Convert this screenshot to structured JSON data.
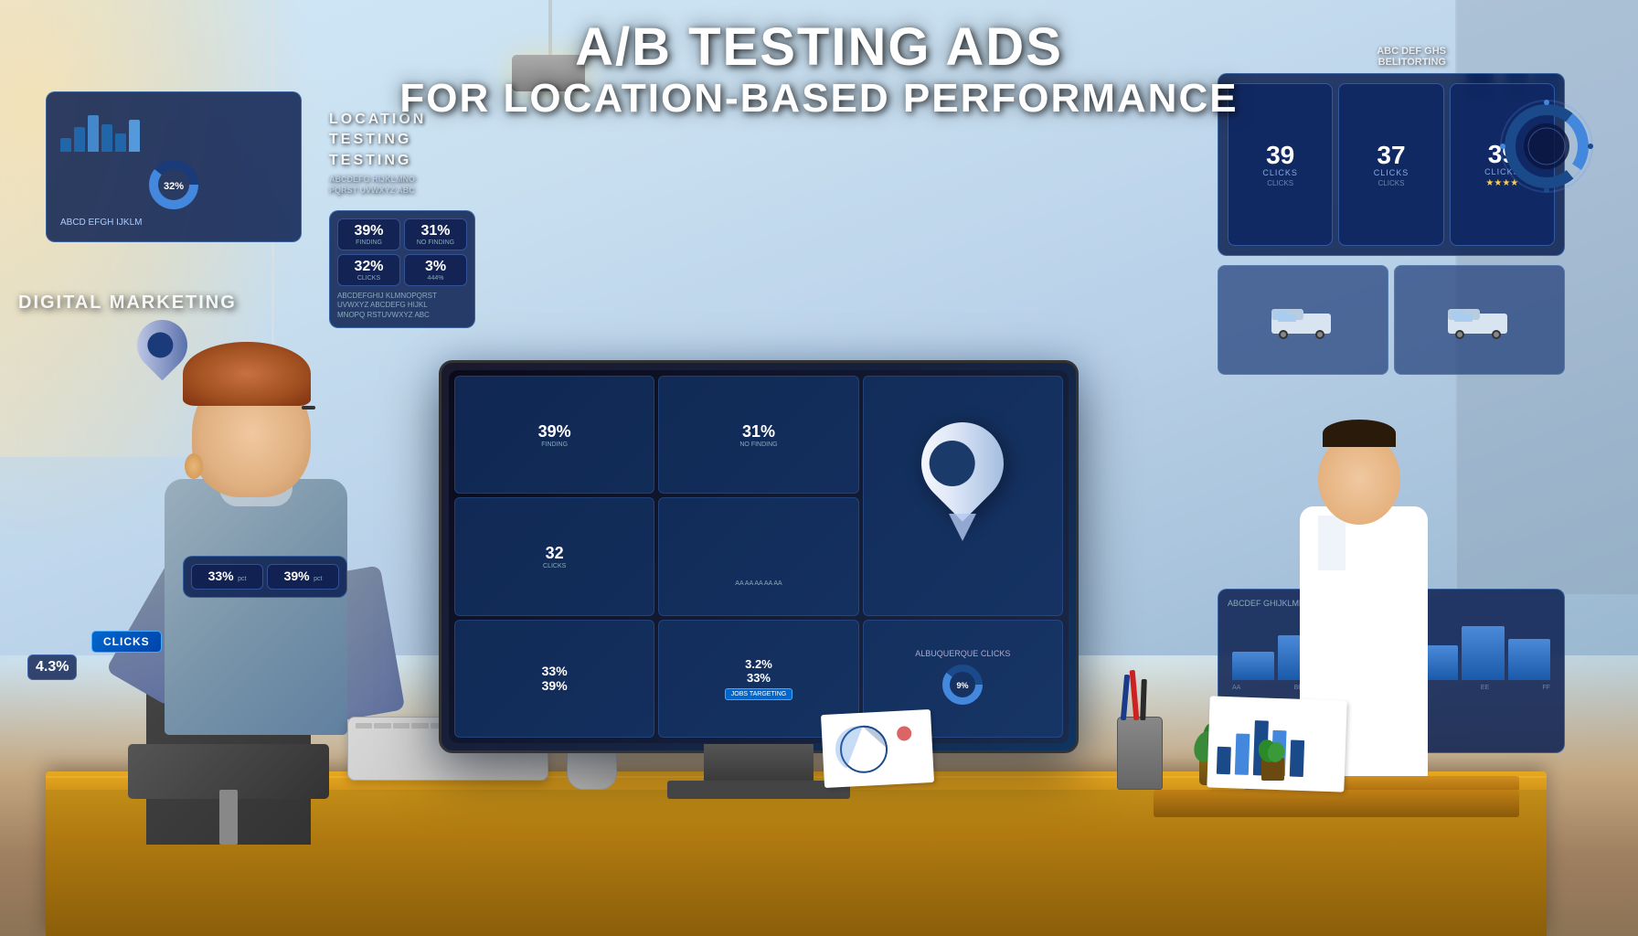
{
  "title": {
    "line1": "A/B TESTING ADS",
    "line2": "FOR LOCATION-BASED PERFORMANCE"
  },
  "overlay_text": {
    "digital_marketing": "DIGITAL MARKETING",
    "location_testing": "LOCATION\nTESTING\nTESTING",
    "pct_left_top": "39%",
    "pct_left_mid": "31%",
    "pct_left_bot": "32%",
    "pct_left_bot2": "3%",
    "pct_small1": "33%",
    "pct_small2": "39%",
    "pct_small3": "3.2%",
    "pct_small4": "33%",
    "pct_percentage": "4.3%"
  },
  "clicks_stats": [
    {
      "number": "39",
      "label": "CLICKS"
    },
    {
      "number": "37",
      "label": "CLICKS"
    },
    {
      "number": "39",
      "label": "CLICKS"
    }
  ],
  "monitor_stats": [
    {
      "value": "39%",
      "sub": "FINDING"
    },
    {
      "value": "31%",
      "sub": "NO FINDING"
    },
    {
      "value": "32",
      "sub": "CLICKS"
    },
    {
      "value": "3%",
      "sub": "444%"
    }
  ],
  "bar_chart_main": {
    "bars": [
      30,
      50,
      80,
      60,
      45
    ],
    "labels": [
      "AA",
      "AA",
      "AA",
      "AA",
      "AA"
    ]
  },
  "bar_chart_right": {
    "bars": [
      40,
      65,
      90,
      70,
      55,
      80
    ],
    "labels": []
  },
  "bottom_stats": {
    "pct": "33%",
    "clicks_label": "CLICKS",
    "additional": "9%"
  },
  "donut": {
    "value": 32,
    "label": "32%"
  },
  "colors": {
    "primary_blue": "#1a3a8a",
    "accent_blue": "#4488dd",
    "dark_bg": "#0a0a1a",
    "panel_bg": "rgba(10,30,80,0.85)",
    "text_white": "#ffffff"
  }
}
